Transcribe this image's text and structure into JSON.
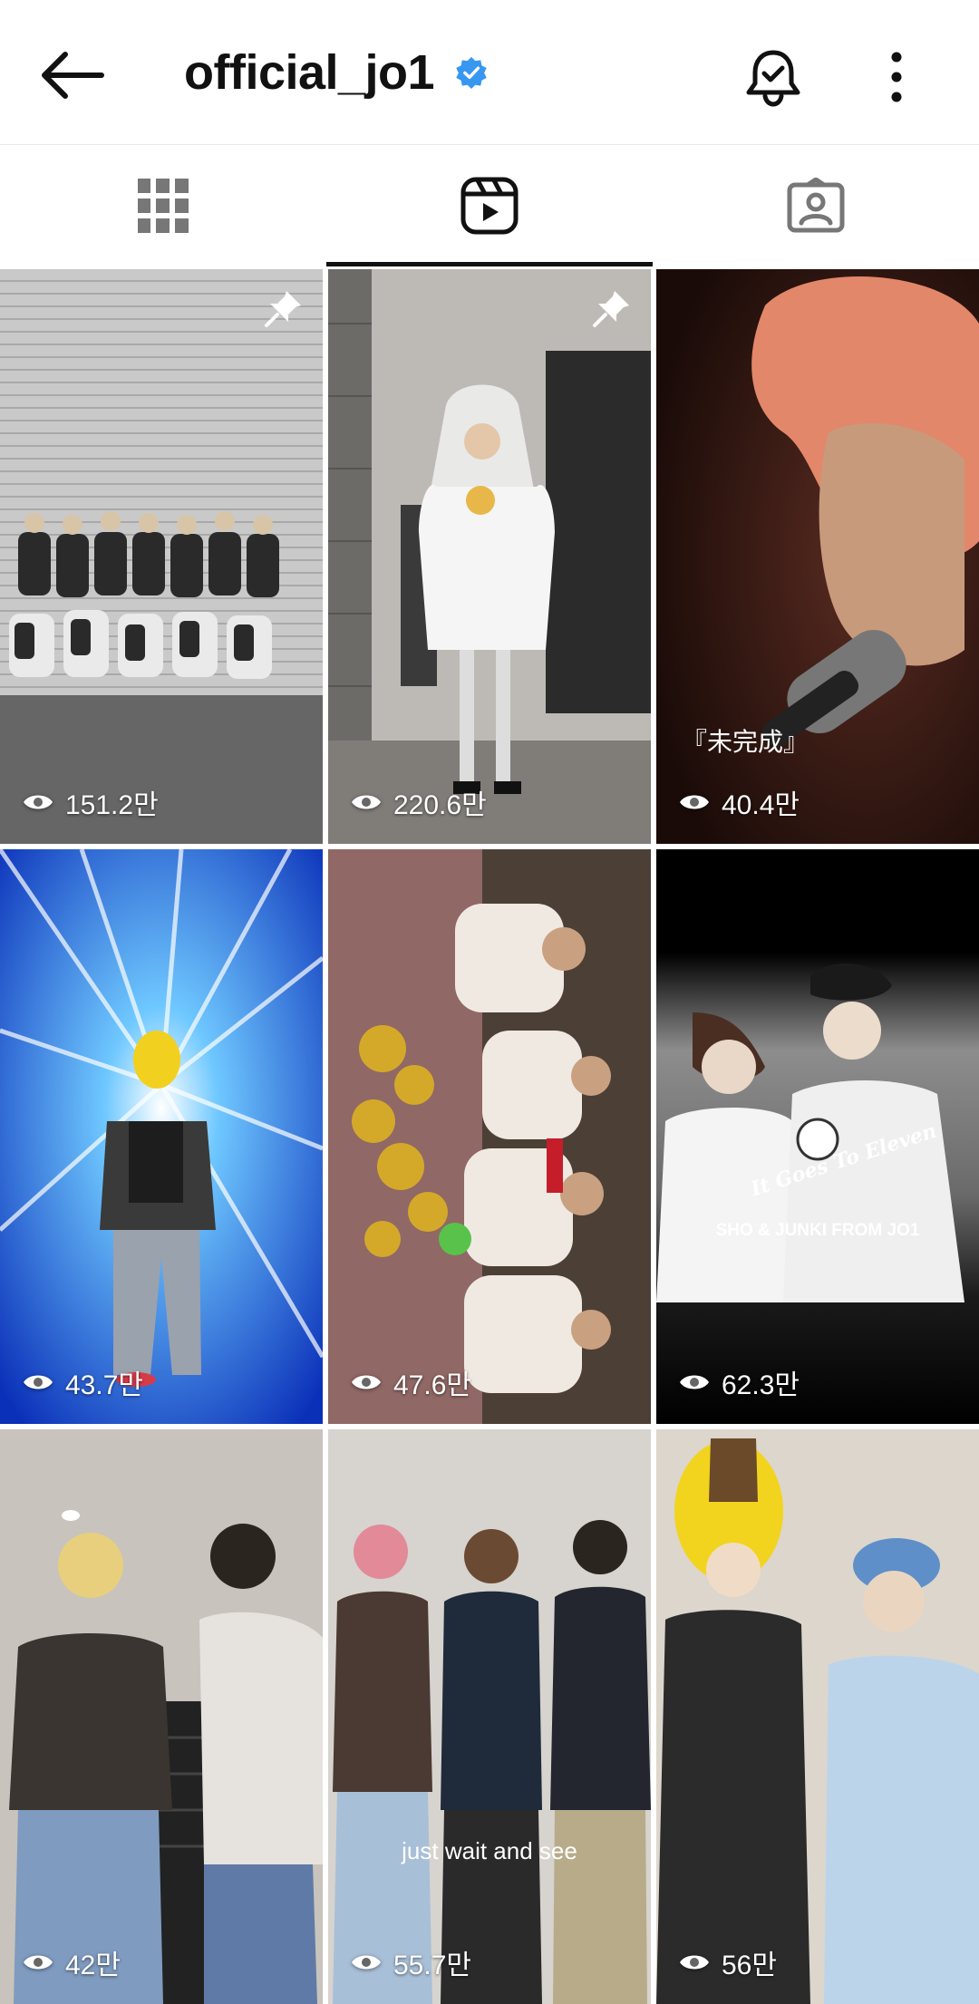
{
  "header": {
    "username": "official_jo1",
    "verified": true,
    "icons": [
      "arrow-left-icon",
      "verified-badge-icon",
      "bell-check-icon",
      "more-vertical-icon"
    ]
  },
  "tabs": [
    {
      "name": "grid",
      "icon": "grid-icon",
      "active": false
    },
    {
      "name": "reels",
      "icon": "reels-icon",
      "active": true
    },
    {
      "name": "tagged",
      "icon": "tagged-user-icon",
      "active": false
    }
  ],
  "reels": [
    {
      "views": "151.2만",
      "pinned": true
    },
    {
      "views": "220.6만",
      "pinned": true
    },
    {
      "views": "40.4만",
      "pinned": false,
      "overlay": "『未完成』"
    },
    {
      "views": "43.7만",
      "pinned": false
    },
    {
      "views": "47.6만",
      "pinned": false
    },
    {
      "views": "62.3만",
      "pinned": false,
      "overlay": "It Goes To Eleven",
      "overlay2": "SHO & JUNKI FROM JO1"
    },
    {
      "views": "42만",
      "pinned": false
    },
    {
      "views": "55.7만",
      "pinned": false,
      "overlay": "just wait and see"
    },
    {
      "views": "56만",
      "pinned": false
    }
  ],
  "colors": {
    "verified": "#3897f0",
    "active_tab": "#111111",
    "inactive_icon": "#777777"
  }
}
